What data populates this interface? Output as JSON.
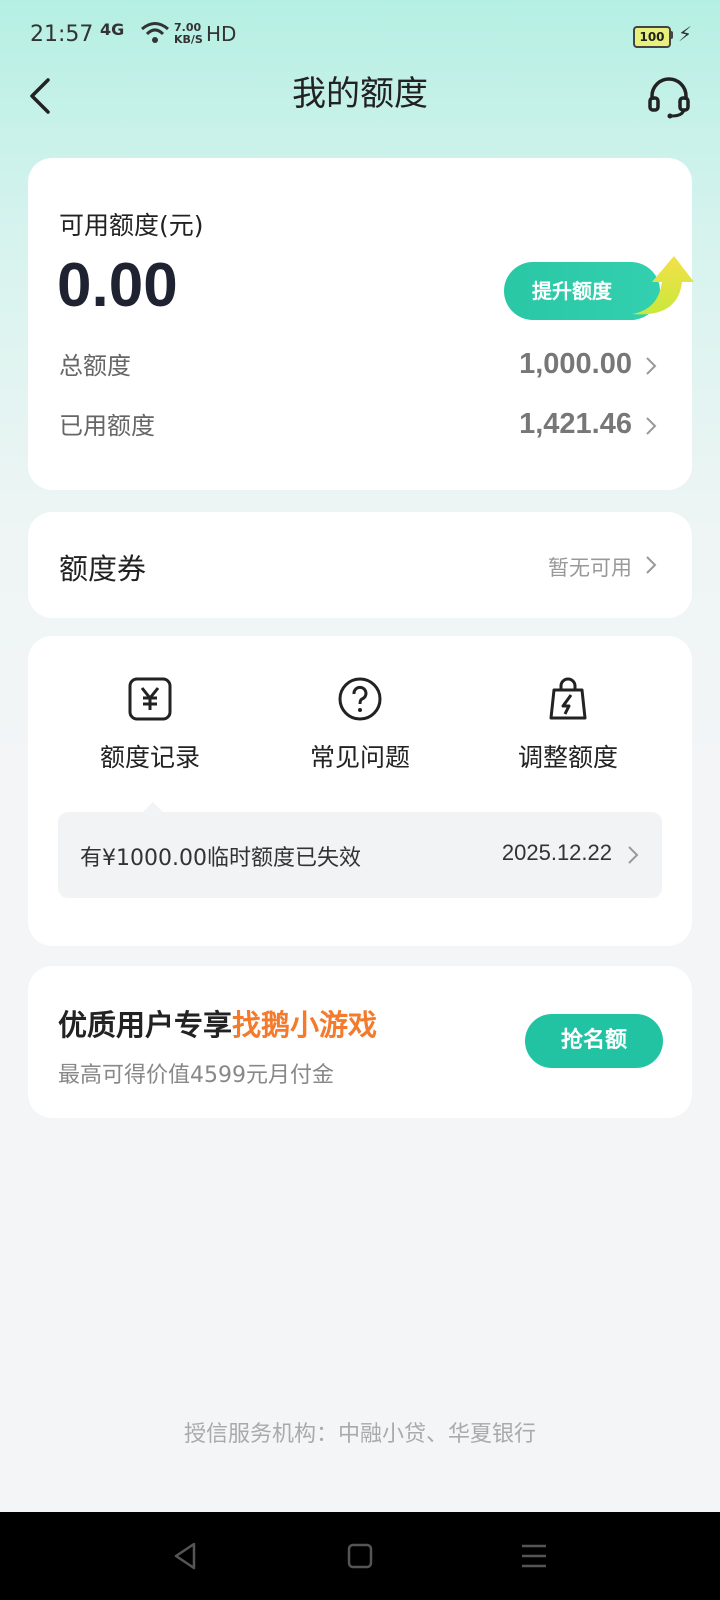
{
  "status_bar": {
    "time": "21:57",
    "signal": "4G",
    "net_speed_line1": "7.00",
    "net_speed_line2": "KB/S",
    "hd": "HD",
    "battery": "100"
  },
  "header": {
    "title": "我的额度",
    "back_icon": "back-arrow-icon",
    "service_icon": "headset-icon"
  },
  "limit_card": {
    "available_label": "可用额度(元)",
    "available_amount": "0.00",
    "raise_button": "提升额度",
    "total_label": "总额度",
    "total_value": "1,000.00",
    "used_label": "已用额度",
    "used_value": "1,421.46"
  },
  "coupon": {
    "title": "额度券",
    "status": "暂无可用"
  },
  "tools": {
    "items": [
      {
        "label": "额度记录",
        "icon": "yuan-record-icon"
      },
      {
        "label": "常见问题",
        "icon": "question-icon"
      },
      {
        "label": "调整额度",
        "icon": "bag-bolt-icon"
      }
    ],
    "notice_text": "有¥1000.00临时额度已失效",
    "notice_date": "2025.12.22"
  },
  "promo": {
    "title_prefix": "优质用户专享",
    "title_highlight": "找鹅小游戏",
    "subtitle": "最高可得价值4599元月付金",
    "button": "抢名额"
  },
  "footer": {
    "text": "授信服务机构：中融小贷、华夏银行"
  },
  "colors": {
    "accent": "#22c3a3",
    "highlight": "#f47a2c"
  }
}
